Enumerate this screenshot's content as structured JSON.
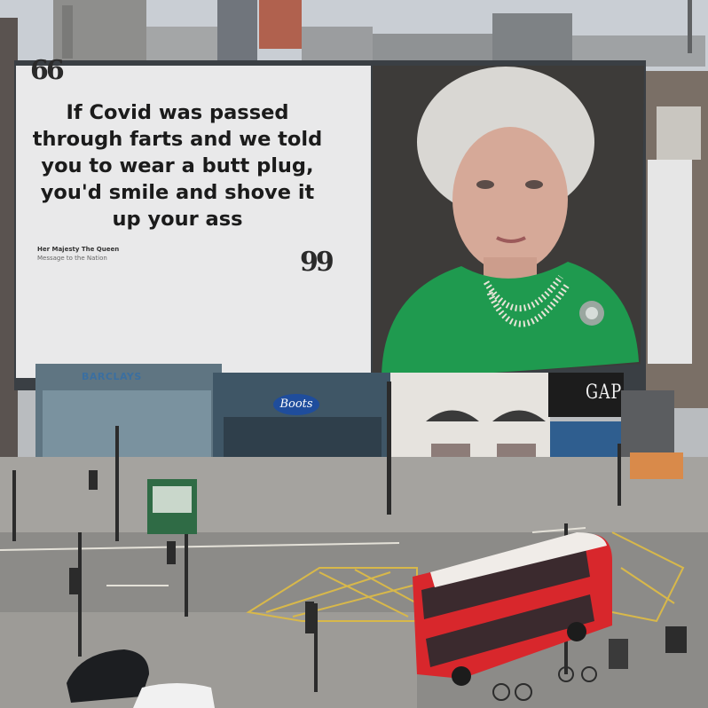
{
  "billboard": {
    "open_quote": "66",
    "close_quote": "99",
    "quote_lines": [
      "If Covid was passed",
      "through farts and we told",
      "you to wear a butt plug,",
      "you'd smile and shove it",
      "up your ass"
    ],
    "attribution_name": "Her Majesty The Queen",
    "attribution_sub": "Message to the Nation"
  },
  "storefronts": {
    "barclays": "BARCLAYS",
    "boots": "Boots",
    "gap": "GAP"
  },
  "colors": {
    "billboard_panel": "#e9e9ea",
    "queen_dress": "#1f9a4f",
    "bus_red": "#d8272c",
    "boots_blue": "#1f4d9c",
    "road_line_yellow": "#d8b84a"
  }
}
